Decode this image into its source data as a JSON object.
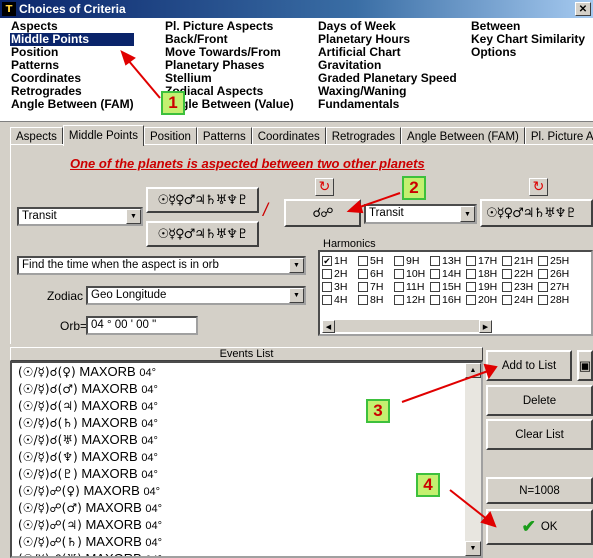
{
  "window": {
    "title": "Choices of Criteria",
    "app_icon": "T",
    "close_glyph": "✕"
  },
  "criteria": {
    "columns": [
      [
        "Aspects",
        "Middle Points",
        "Position",
        "Patterns",
        "Coordinates",
        "Retrogrades",
        "Angle Between (FAM)"
      ],
      [
        "Pl. Picture Aspects",
        "Back/Front",
        "Move Towards/From",
        "Planetary Phases",
        "Stellium",
        "Zodiacal Aspects",
        "Angle Between (Value)"
      ],
      [
        "Days of Week",
        "Planetary Hours",
        "Artificial Chart",
        "Gravitation",
        "Graded Planetary Speed",
        "Waxing/Waning",
        "Fundamentals"
      ],
      [
        "Between",
        "Key Chart Similarity",
        "Options"
      ]
    ],
    "selected": "Middle Points"
  },
  "tabs": [
    "Aspects",
    "Middle Points",
    "Position",
    "Patterns",
    "Coordinates",
    "Retrogrades",
    "Angle Between (FAM)",
    "Pl. Picture Aspects"
  ],
  "active_tab": "Middle Points",
  "midpoint": {
    "headline": "One of the planets is aspected between two other planets",
    "left_transit": "Transit",
    "right_transit": "Transit",
    "planet_glyphs": "☉☿♀♂♃♄♅♆♇",
    "slash": "/",
    "aspect_button": "☌☍",
    "refresh_glyph": "↻",
    "find_time": "Find the time when the aspect is in orb",
    "zodiac_label": "Zodiac",
    "zodiac_value": "Geo Longitude",
    "orb_label": "Orb=",
    "orb_value": "04 ° 00 ' 00 \""
  },
  "harmonics": {
    "title": "Harmonics",
    "rows": [
      [
        "1H",
        "5H",
        "9H",
        "13H",
        "17H",
        "21H",
        "25H"
      ],
      [
        "2H",
        "6H",
        "10H",
        "14H",
        "18H",
        "22H",
        "26H"
      ],
      [
        "3H",
        "7H",
        "11H",
        "15H",
        "19H",
        "23H",
        "27H"
      ],
      [
        "4H",
        "8H",
        "12H",
        "16H",
        "20H",
        "24H",
        "28H"
      ]
    ],
    "checked": "1H",
    "check_glyph": "✔"
  },
  "events": {
    "header": "Events List",
    "rows": [
      {
        "g": "(☉/☿)☌(♀)",
        "t": "MAXORB",
        "o": "04°"
      },
      {
        "g": "(☉/☿)☌(♂)",
        "t": "MAXORB",
        "o": "04°"
      },
      {
        "g": "(☉/☿)☌(♃)",
        "t": "MAXORB",
        "o": "04°"
      },
      {
        "g": "(☉/☿)☌(♄)",
        "t": "MAXORB",
        "o": "04°"
      },
      {
        "g": "(☉/☿)☌(♅)",
        "t": "MAXORB",
        "o": "04°"
      },
      {
        "g": "(☉/☿)☌(♆)",
        "t": "MAXORB",
        "o": "04°"
      },
      {
        "g": "(☉/☿)☌(♇)",
        "t": "MAXORB",
        "o": "04°"
      },
      {
        "g": "(☉/☿)☍(♀)",
        "t": "MAXORB",
        "o": "04°"
      },
      {
        "g": "(☉/☿)☍(♂)",
        "t": "MAXORB",
        "o": "04°"
      },
      {
        "g": "(☉/☿)☍(♃)",
        "t": "MAXORB",
        "o": "04°"
      },
      {
        "g": "(☉/☿)☍(♄)",
        "t": "MAXORB",
        "o": "04°"
      },
      {
        "g": "(☉/☿)☍(♅)",
        "t": "MAXORB",
        "o": "04°"
      }
    ]
  },
  "actions": {
    "add": "Add to List",
    "delete": "Delete",
    "clear": "Clear List",
    "count": "N=1008",
    "ok": "OK",
    "ok_icon": "✔"
  },
  "markers": [
    "1",
    "2",
    "3",
    "4"
  ],
  "colors": {
    "annotation_red": "#e00000",
    "marker_fill": "#c4f070",
    "selection": "#0a246a"
  }
}
